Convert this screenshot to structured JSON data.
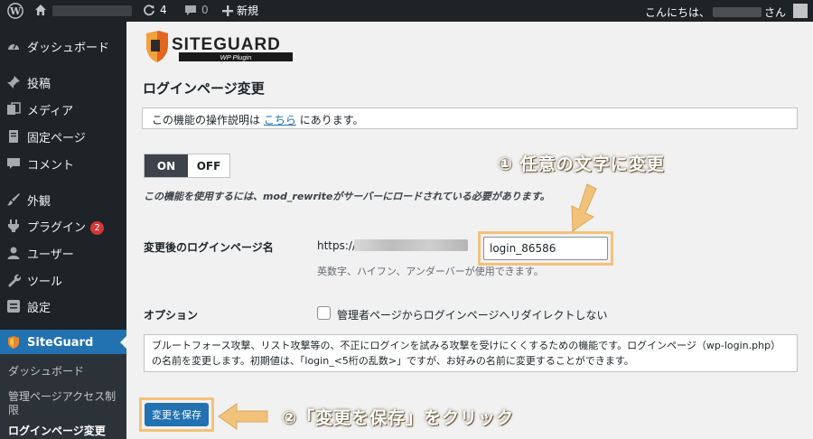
{
  "adminbar": {
    "updates_count": "4",
    "comments_count": "0",
    "new_label": "新規",
    "greeting": "こんにちは、",
    "honorific": "さん"
  },
  "sidebar": {
    "items": [
      {
        "label": "ダッシュボード",
        "icon": "dashboard-icon"
      },
      {
        "label": "投稿",
        "icon": "pin-icon"
      },
      {
        "label": "メディア",
        "icon": "media-icon"
      },
      {
        "label": "固定ページ",
        "icon": "page-icon"
      },
      {
        "label": "コメント",
        "icon": "comment-icon"
      },
      {
        "label": "外観",
        "icon": "brush-icon"
      },
      {
        "label": "プラグイン",
        "icon": "plugin-icon",
        "badge": "2"
      },
      {
        "label": "ユーザー",
        "icon": "user-icon"
      },
      {
        "label": "ツール",
        "icon": "wrench-icon"
      },
      {
        "label": "設定",
        "icon": "settings-icon"
      },
      {
        "label": "SiteGuard",
        "icon": "siteguard-icon"
      }
    ],
    "submenu": [
      "ダッシュボード",
      "管理ページアクセス制限",
      "ログインページ変更"
    ]
  },
  "logo": {
    "title": "SITEGUARD",
    "sub": "WP Plugin"
  },
  "main": {
    "page_title": "ログインページ変更",
    "notice_prefix": "この機能の操作説明は",
    "notice_link": "こちら",
    "notice_suffix": "にあります。",
    "toggle_on": "ON",
    "toggle_off": "OFF",
    "requirement": "この機能を使用するには、mod_rewriteがサーバーにロードされている必要があります。",
    "new_page_label": "変更後のログインページ名",
    "url_prefix": "https://",
    "login_value": "login_86586",
    "hint": "英数字、ハイフン、アンダーバーが使用できます。",
    "option_label": "オプション",
    "option_checkbox": "管理者ページからログインページへリダイレクトしない",
    "description_line1": "ブルートフォース攻撃、リスト攻撃等の、不正にログインを試みる攻撃を受けにくくするための機能です。ログインページ（wp-login.php）",
    "description_line2": "の名前を変更します。初期値は、「login_<5桁の乱数>」ですが、お好みの名前に変更することができます。",
    "save_label": "変更を保存"
  },
  "annotations": {
    "step1": "① 任意の文字に変更",
    "step2": "②「変更を保存」をクリック"
  },
  "colors": {
    "accent": "#2271b1",
    "highlight": "#f3c27a",
    "admin_dark": "#1d2327",
    "badge": "#d63638"
  }
}
